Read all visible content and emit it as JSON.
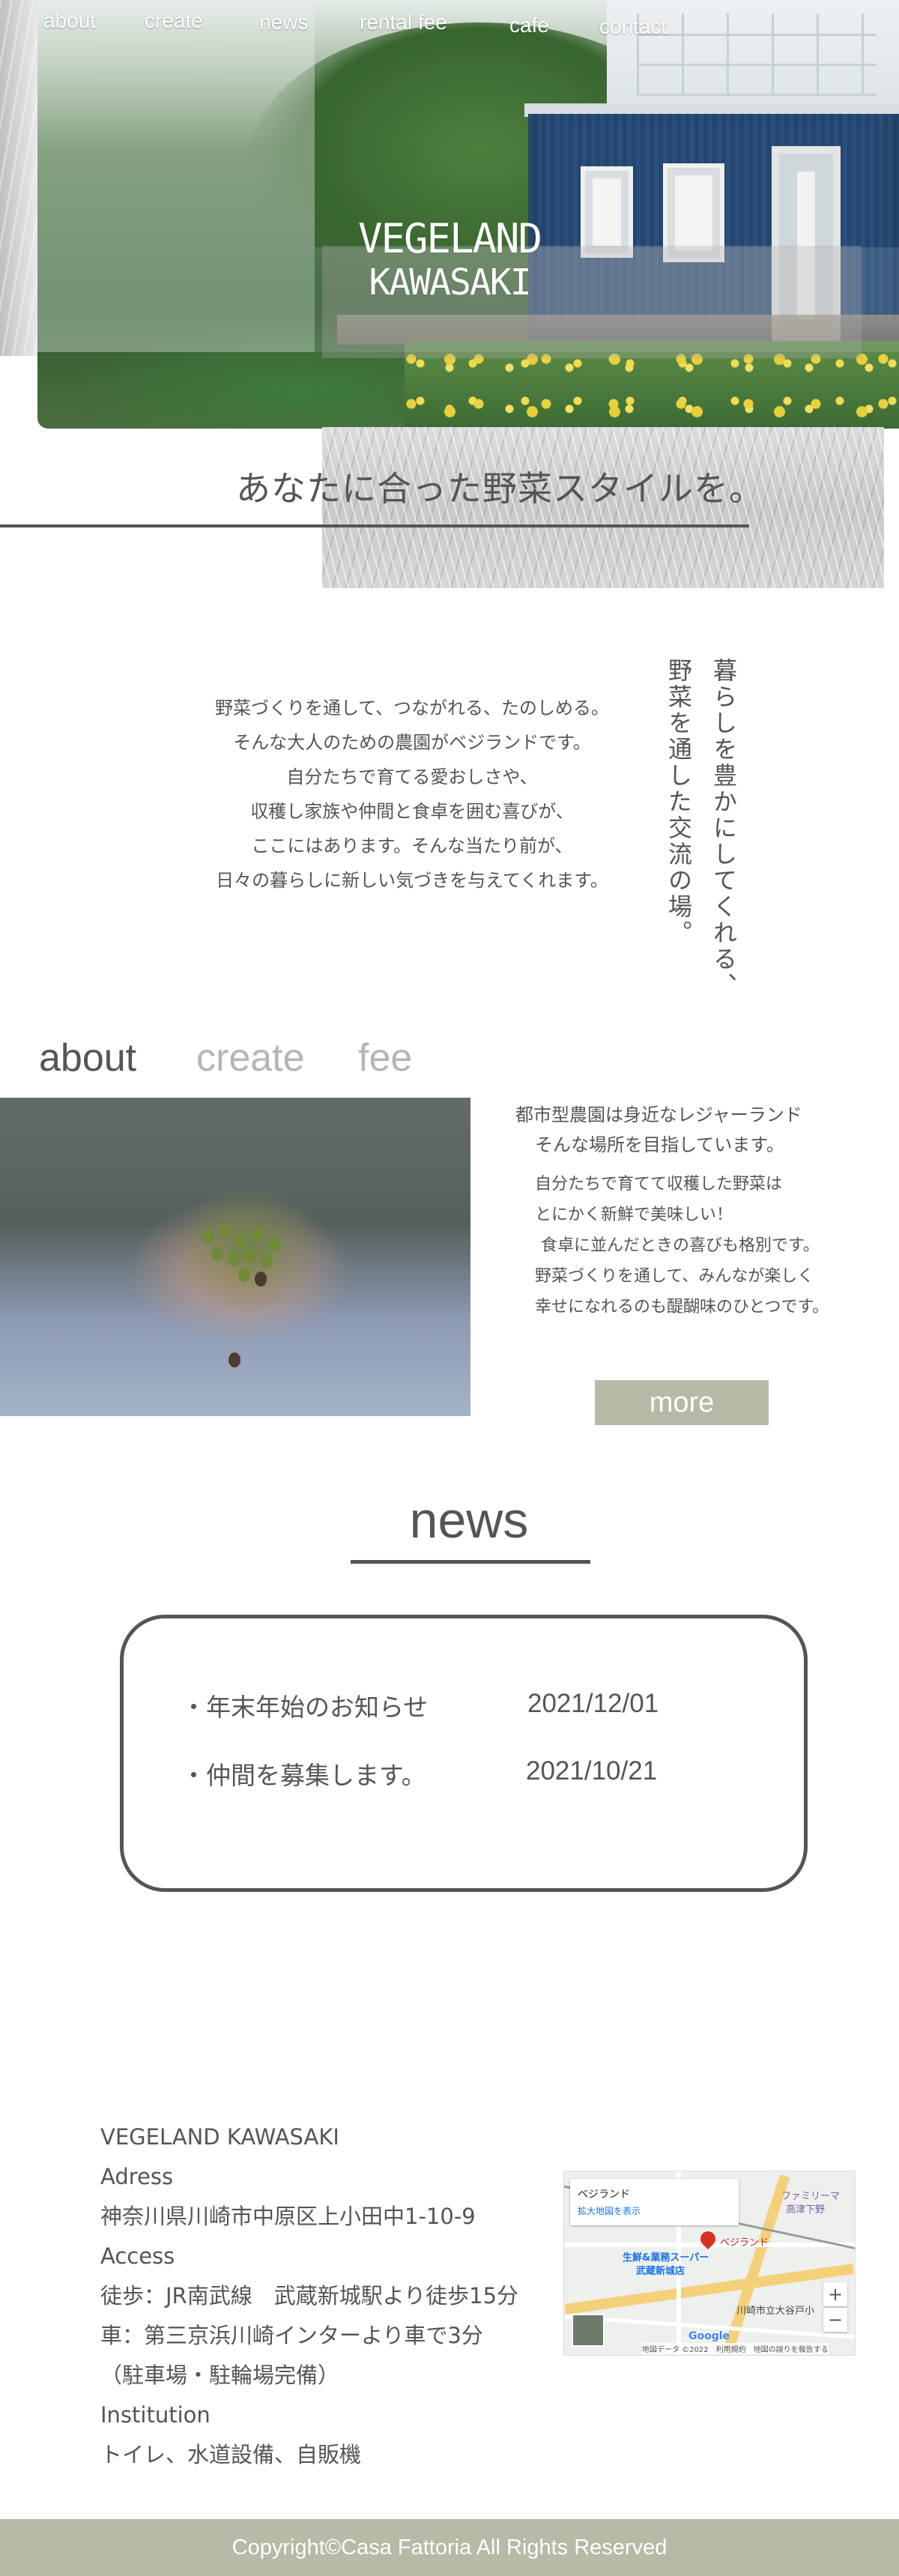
{
  "nav": {
    "items": [
      "about",
      "create",
      "news",
      "rental fee",
      "cafe",
      "contact"
    ]
  },
  "hero": {
    "title_line1": "VEGELAND",
    "title_line2": "KAWASAKI"
  },
  "tagline": "あなたに合った野菜スタイルを。",
  "intro": {
    "lines": [
      "野菜づくりを通して、つながれる、たのしめる。",
      "そんな大人のための農園がベジランドです。",
      "自分たちで育てる愛おしさや、",
      "収穫し家族や仲間と食卓を囲む喜びが、",
      "ここにはあります。そんな当たり前が、",
      "日々の暮らしに新しい気づきを与えてくれます。"
    ],
    "vertical_line1": "暮らしを豊かにしてくれる、",
    "vertical_line2": "野菜を通した交流の場。"
  },
  "about": {
    "tabs": [
      "about",
      "create",
      "fee"
    ],
    "active_tab": "about",
    "lead_lines": [
      "都市型農園は身近なレジャーランド",
      "そんな場所を目指しています。"
    ],
    "body_lines": [
      "自分たちで育てて収穫した野菜は",
      "とにかく新鮮で美味しい！",
      "食卓に並んだときの喜びも格別です。",
      "野菜づくりを通して、みんなが楽しく",
      "幸せになれるのも醍醐味のひとつです。"
    ],
    "more_label": "more"
  },
  "news": {
    "title": "news",
    "items": [
      {
        "title": "・年末年始のお知らせ",
        "date": "2021/12/01"
      },
      {
        "title": "・仲間を募集します。",
        "date": "2021/10/21"
      }
    ]
  },
  "info": {
    "lines": [
      "VEGELAND KAWASAKI",
      "Adress",
      "神奈川県川崎市中原区上小田中1-10-9",
      "Access",
      "徒歩：JR南武線　武蔵新城駅より徒歩15分",
      "車：第三京浜川崎インターより車で3分",
      "（駐車場・駐輪場完備）",
      "Institution",
      "トイレ、水道設備、自販機"
    ]
  },
  "map": {
    "place_name": "ベジランド",
    "enlarge_link": "拡大地図を表示",
    "pin_label": "ベジランド",
    "poi_1": "生鮮&業務スーパー",
    "poi_2": "武蔵新城店",
    "poi_3": "川崎市立大谷戸小",
    "poi_4": "ファミリーマ",
    "poi_5": "高津下野",
    "brand": "Google",
    "credit": "地図データ ©2022　利用規約　地図の誤りを報告する",
    "zoom_in": "+",
    "zoom_out": "−"
  },
  "footer": {
    "copyright": "Copyright©Casa Fattoria All Rights Reserved"
  },
  "colors": {
    "text": "#555555",
    "accent_olive": "#b8b9a6",
    "muted_tab": "#b5b5b5"
  }
}
